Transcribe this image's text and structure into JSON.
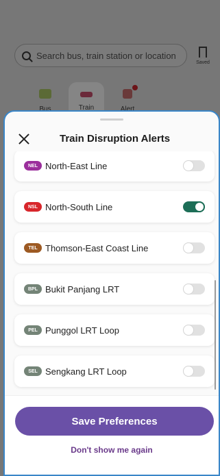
{
  "background": {
    "search": {
      "placeholder": "Search bus, train station or location"
    },
    "saved_label": "Saved",
    "tabs": [
      {
        "label": "Bus",
        "icon": "bus-icon"
      },
      {
        "label": "Train",
        "icon": "train-icon"
      },
      {
        "label": "Alert",
        "icon": "alert-icon"
      }
    ]
  },
  "sheet": {
    "title": "Train Disruption Alerts",
    "lines": [
      {
        "code": "NEL",
        "name": "North-East Line",
        "color": "#9b2f9c",
        "enabled": false
      },
      {
        "code": "NSL",
        "name": "North-South Line",
        "color": "#d8262b",
        "enabled": true
      },
      {
        "code": "TEL",
        "name": "Thomson-East Coast Line",
        "color": "#9d5a23",
        "enabled": false
      },
      {
        "code": "BPL",
        "name": "Bukit Panjang LRT",
        "color": "#748477",
        "enabled": false
      },
      {
        "code": "PEL",
        "name": "Punggol LRT Loop",
        "color": "#748477",
        "enabled": false
      },
      {
        "code": "SEL",
        "name": "Sengkang LRT Loop",
        "color": "#748477",
        "enabled": false
      }
    ],
    "save_label": "Save Preferences",
    "dont_show_label": "Don't show me again"
  }
}
